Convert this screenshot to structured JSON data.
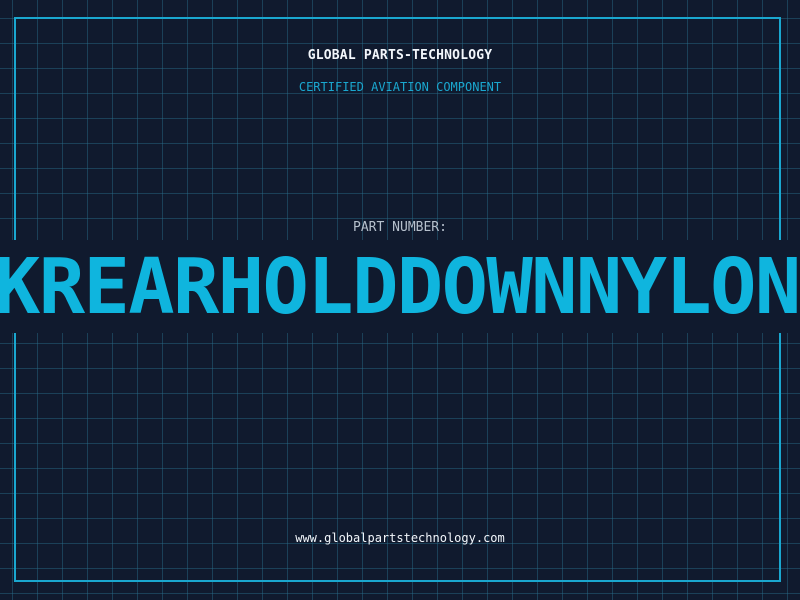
{
  "header": {
    "company": "GLOBAL PARTS-TECHNOLOGY",
    "subtitle": "CERTIFIED AVIATION COMPONENT"
  },
  "part": {
    "label": "PART NUMBER:",
    "number": "KREARHOLDDOWNNYLON"
  },
  "footer": {
    "url": "www.globalpartstechnology.com"
  },
  "colors": {
    "background": "#101a2e",
    "accent": "#1aa7cf",
    "text": "#f2f6fb"
  }
}
